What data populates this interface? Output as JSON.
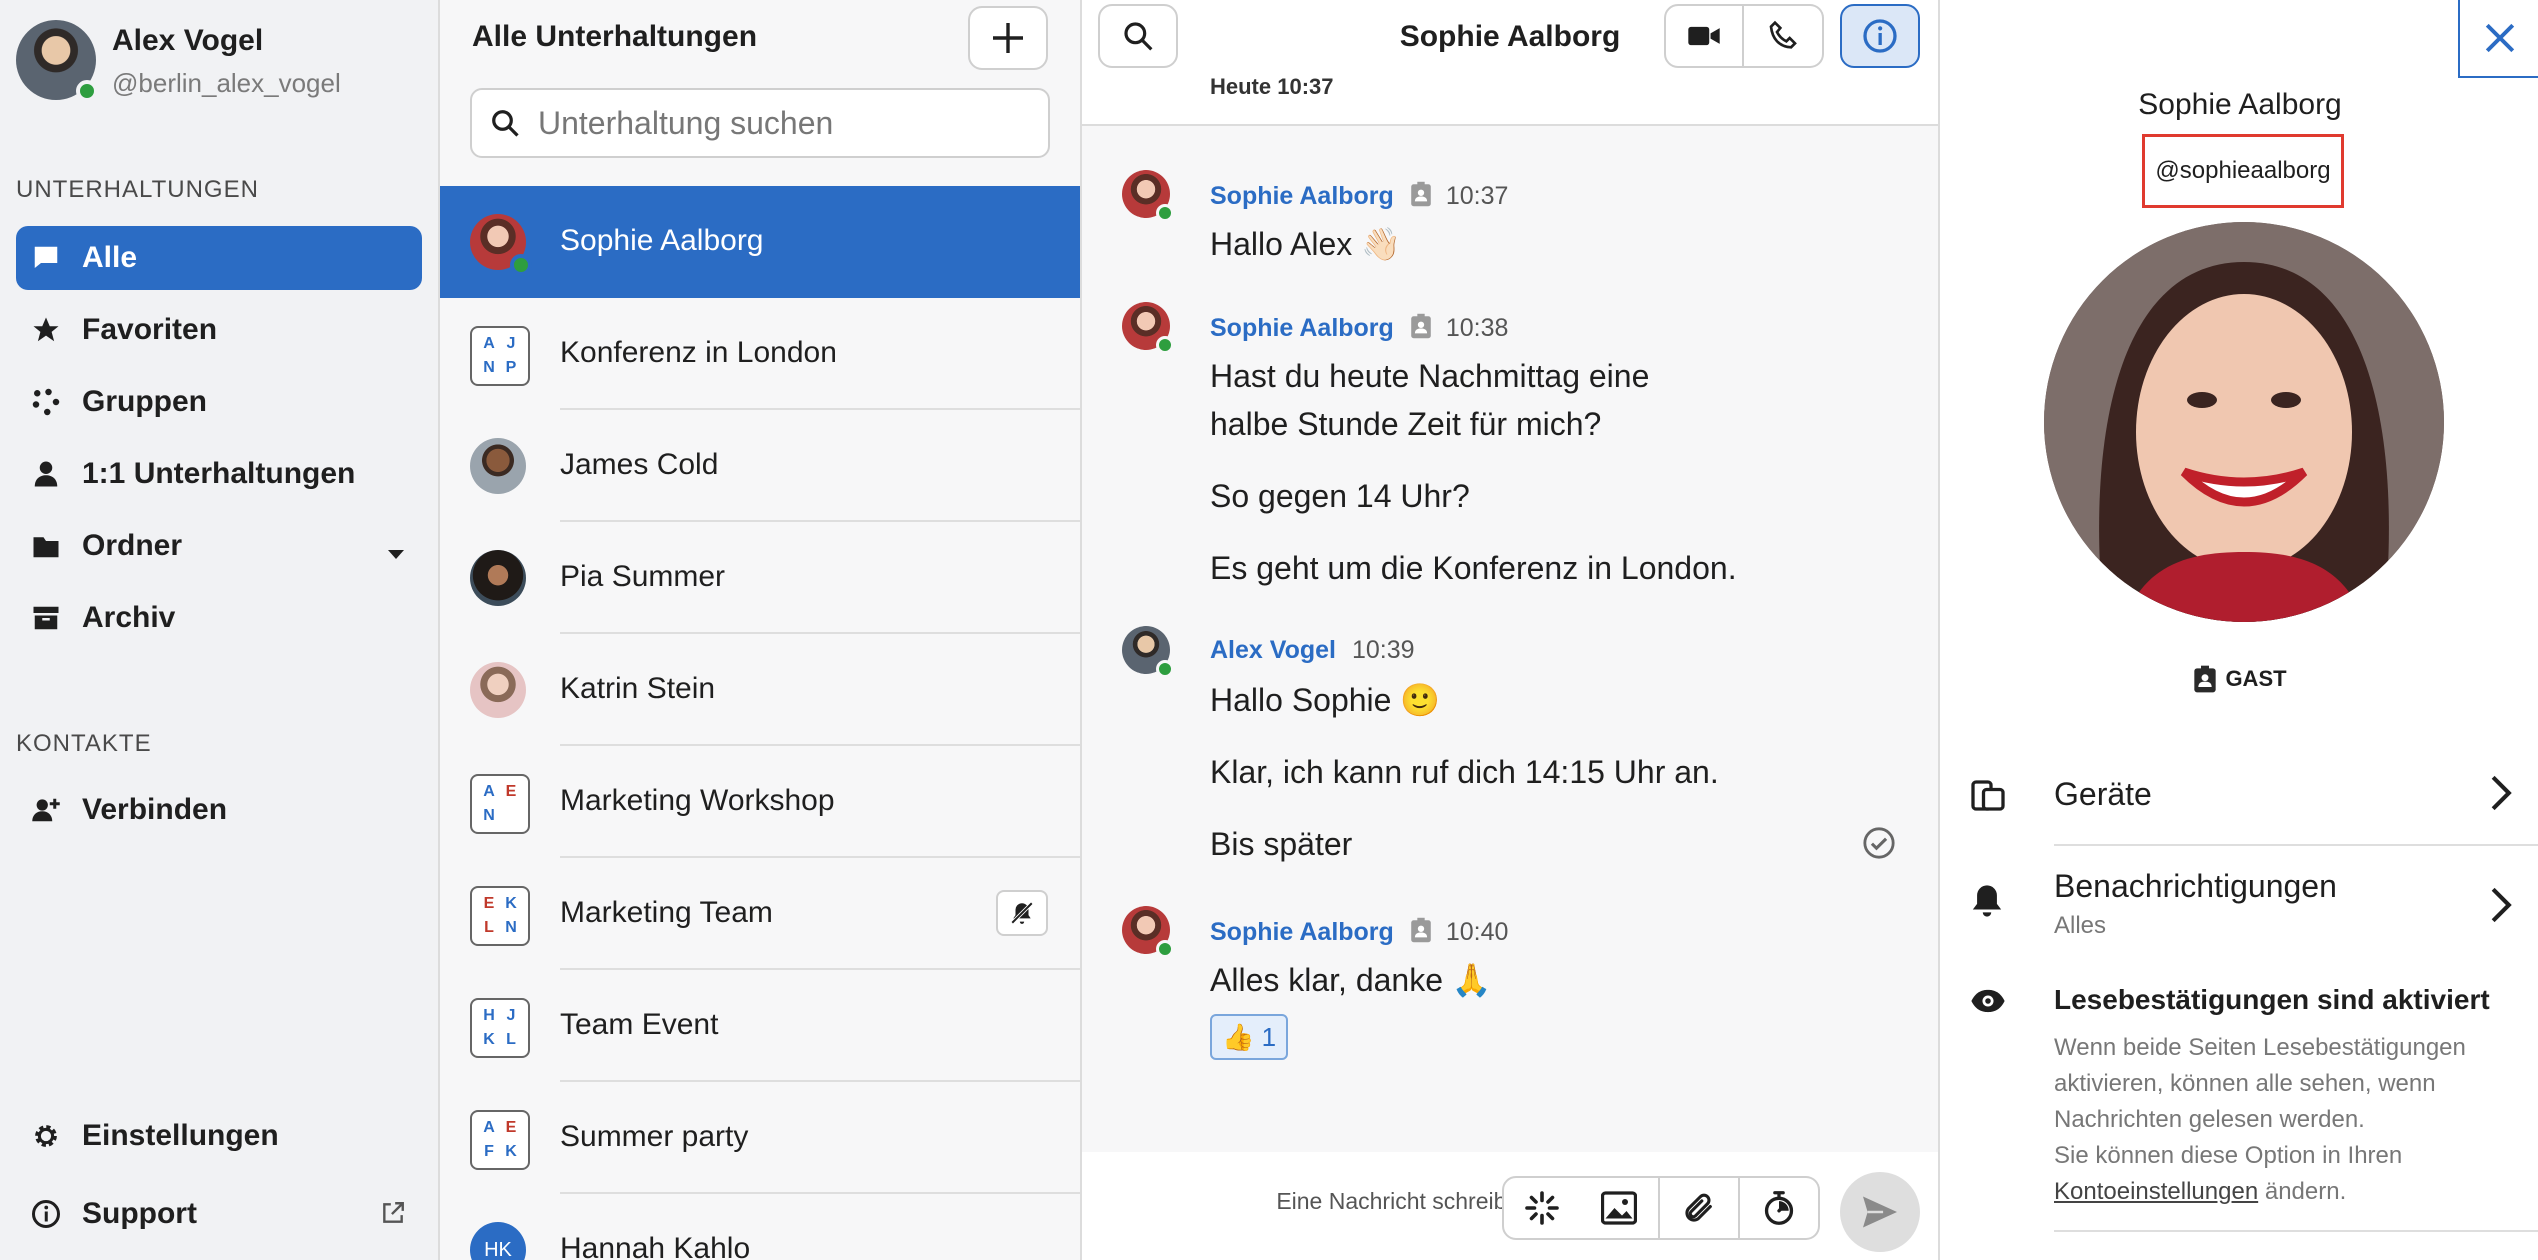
{
  "user": {
    "name": "Alex Vogel",
    "handle": "@berlin_alex_vogel"
  },
  "sidebar": {
    "conversations_heading": "UNTERHALTUNGEN",
    "nav": [
      {
        "label": "Alle",
        "icon": "chat-bubble-icon",
        "active": true
      },
      {
        "label": "Favoriten",
        "icon": "star-icon"
      },
      {
        "label": "Gruppen",
        "icon": "groups-icon"
      },
      {
        "label": "1:1 Unterhaltungen",
        "icon": "person-icon"
      },
      {
        "label": "Ordner",
        "icon": "folder-icon"
      },
      {
        "label": "Archiv",
        "icon": "archive-icon"
      }
    ],
    "contacts_heading": "KONTAKTE",
    "connect_label": "Verbinden",
    "settings_label": "Einstellungen",
    "support_label": "Support"
  },
  "conversation_list": {
    "title": "Alle Unterhaltungen",
    "search_placeholder": "Unterhaltung suchen",
    "items": [
      {
        "name": "Sophie Aalborg",
        "type": "person",
        "active": true
      },
      {
        "name": "Konferenz in London",
        "type": "group",
        "initials": [
          "A",
          "J",
          "N",
          "P"
        ]
      },
      {
        "name": "James Cold",
        "type": "person"
      },
      {
        "name": "Pia Summer",
        "type": "person"
      },
      {
        "name": "Katrin Stein",
        "type": "person"
      },
      {
        "name": "Marketing Workshop",
        "type": "group",
        "initials": [
          "A",
          "E",
          "N",
          ""
        ]
      },
      {
        "name": "Marketing Team",
        "type": "group",
        "initials": [
          "E",
          "K",
          "L",
          "N"
        ],
        "muted": true
      },
      {
        "name": "Team Event",
        "type": "group",
        "initials": [
          "H",
          "J",
          "K",
          "L"
        ]
      },
      {
        "name": "Summer party",
        "type": "group",
        "initials": [
          "A",
          "E",
          "F",
          "K"
        ]
      },
      {
        "name": "Hannah Kahlo",
        "type": "initials",
        "initials_text": "HK"
      }
    ]
  },
  "chat": {
    "title": "Sophie Aalborg",
    "date_label": "Heute 10:37",
    "messages": [
      {
        "sender": "Sophie Aalborg",
        "time": "10:37",
        "guest": true,
        "lines": [
          "Hallo Alex 👋🏻"
        ]
      },
      {
        "sender": "Sophie Aalborg",
        "time": "10:38",
        "guest": true,
        "lines": [
          "Hast du heute Nachmittag eine",
          "halbe Stunde Zeit für mich?",
          "So gegen 14 Uhr?",
          "Es geht um die Konferenz in London."
        ]
      },
      {
        "sender": "Alex Vogel",
        "time": "10:39",
        "guest": false,
        "lines": [
          "Hallo Sophie 🙂",
          "Klar, ich kann ruf dich 14:15 Uhr an.",
          "Bis später"
        ]
      },
      {
        "sender": "Sophie Aalborg",
        "time": "10:40",
        "guest": true,
        "lines": [
          "Alles klar, danke 🙏"
        ]
      }
    ],
    "reaction": {
      "emoji": "👍",
      "count": "1"
    },
    "composer_placeholder": "Eine Nachricht schreiben"
  },
  "details": {
    "name": "Sophie Aalborg",
    "handle": "@sophieaalborg",
    "role_badge": "GAST",
    "devices_label": "Geräte",
    "notifications_label": "Benachrichtigungen",
    "notifications_value": "Alles",
    "receipts_title": "Lesebestätigungen sind aktiviert",
    "receipts_text_1": "Wenn beide Seiten Lesebestätigungen aktivieren, können alle sehen, wenn Nachrichten gelesen werden.",
    "receipts_text_2": "Sie können diese Option in Ihren",
    "receipts_link": "Kontoeinstellungen",
    "receipts_text_3": "ändern."
  },
  "colors": {
    "accent": "#2b6cc4",
    "online": "#2e9e3f",
    "highlight_box": "#e03a2f"
  }
}
